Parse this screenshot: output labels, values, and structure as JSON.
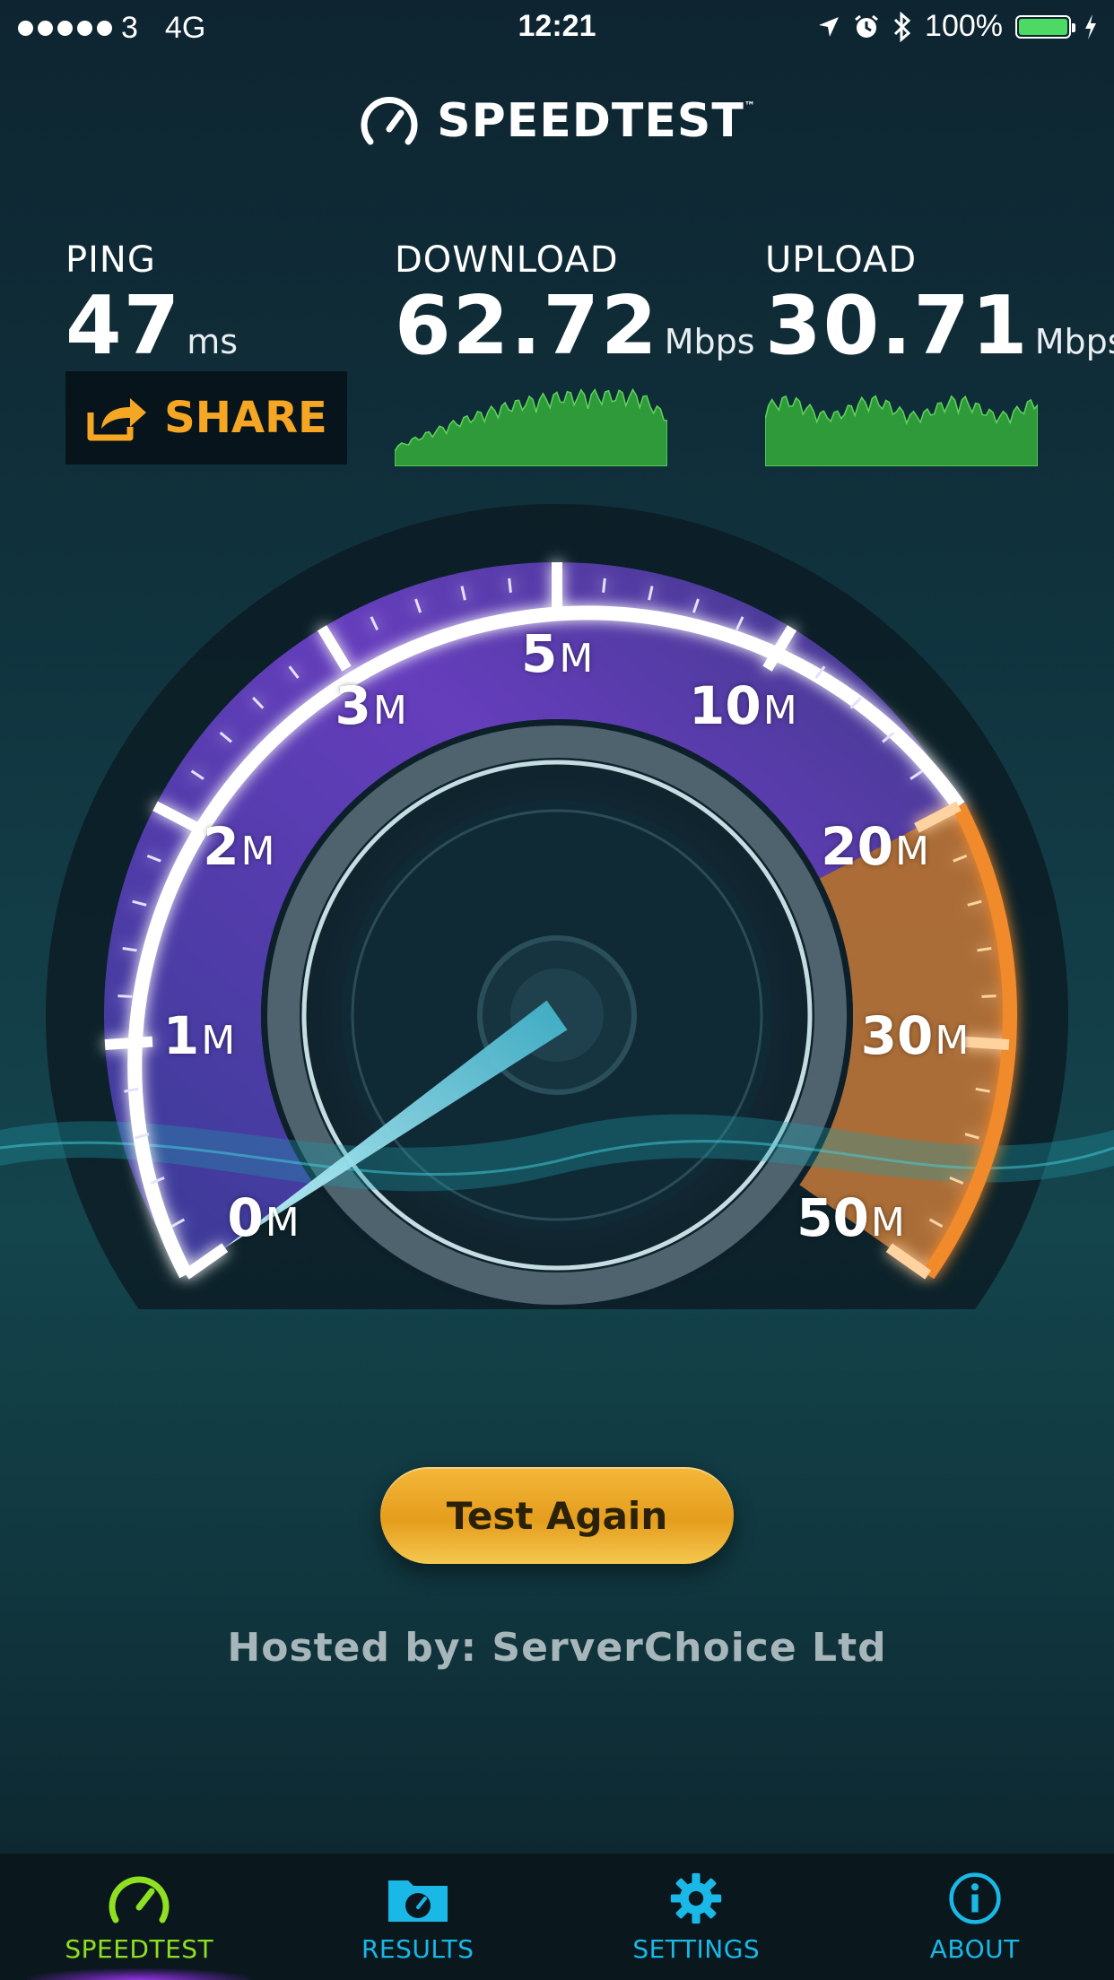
{
  "status_bar": {
    "signal_bars": 5,
    "carrier": "3",
    "network": "4G",
    "time": "12:21",
    "battery": "100%",
    "battery_level": 1.0,
    "icons": [
      "location-arrow-icon",
      "alarm-icon",
      "bluetooth-icon",
      "battery-icon",
      "charging-bolt-icon"
    ]
  },
  "app": {
    "logo_text": "SPEEDTEST",
    "logo_tm": "™"
  },
  "metrics": {
    "ping": {
      "label": "PING",
      "value": "47",
      "unit": "ms"
    },
    "download": {
      "label": "DOWNLOAD",
      "value": "62.72",
      "unit": "Mbps"
    },
    "upload": {
      "label": "UPLOAD",
      "value": "30.71",
      "unit": "Mbps"
    }
  },
  "share": {
    "label": "SHARE",
    "icon": "share-arrow-icon",
    "color": "#f5a623"
  },
  "gauge": {
    "ticks": [
      {
        "value": "0",
        "unit": "M"
      },
      {
        "value": "1",
        "unit": "M"
      },
      {
        "value": "2",
        "unit": "M"
      },
      {
        "value": "3",
        "unit": "M"
      },
      {
        "value": "5",
        "unit": "M"
      },
      {
        "value": "10",
        "unit": "M"
      },
      {
        "value": "20",
        "unit": "M"
      },
      {
        "value": "30",
        "unit": "M"
      },
      {
        "value": "50",
        "unit": "M"
      }
    ],
    "colors": {
      "low": "#6a3fc4",
      "high": "#f08a2a",
      "needle": "#7fe6f2"
    }
  },
  "actions": {
    "test_again": "Test Again",
    "button_color": "#e9a424"
  },
  "hosted_by": "Hosted by: ServerChoice Ltd",
  "tabs": [
    {
      "label": "SPEEDTEST",
      "icon": "speedometer-icon",
      "active": true
    },
    {
      "label": "RESULTS",
      "icon": "results-folder-icon",
      "active": false
    },
    {
      "label": "SETTINGS",
      "icon": "gear-icon",
      "active": false
    },
    {
      "label": "ABOUT",
      "icon": "info-icon",
      "active": false
    }
  ]
}
